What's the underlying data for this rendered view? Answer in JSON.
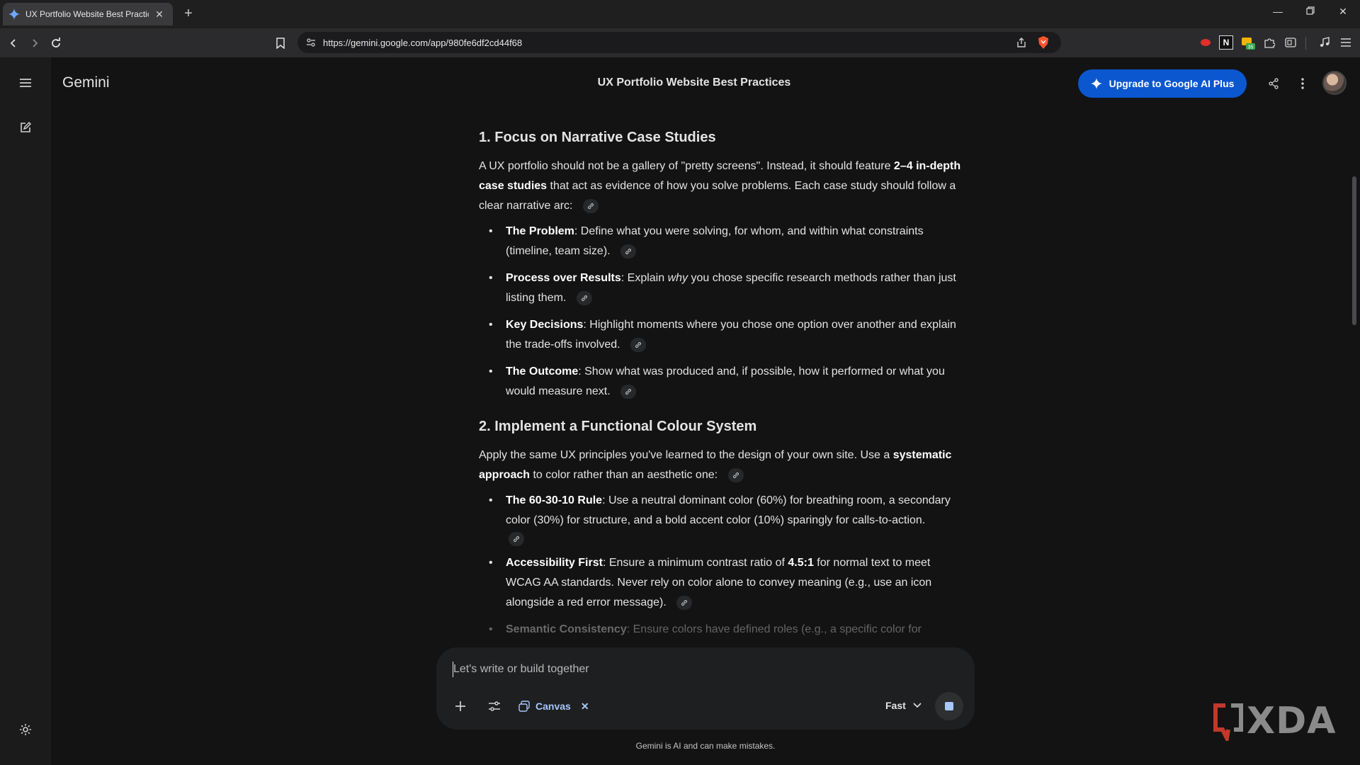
{
  "browser": {
    "tab_title": "UX Portfolio Website Best Practic",
    "url": "https://gemini.google.com/app/980fe6df2cd44f68",
    "extension_badge": "35"
  },
  "app": {
    "brand": "Gemini",
    "conversation_title": "UX Portfolio Website Best Practices",
    "upgrade_label": "Upgrade to Google AI Plus"
  },
  "content": {
    "section1": {
      "heading": "1. Focus on Narrative Case Studies",
      "intro_a": "A UX portfolio should not be a gallery of \"pretty screens\". Instead, it should feature ",
      "intro_bold": "2–4 in-depth case studies",
      "intro_b": " that act as evidence of how you solve problems. Each case study should follow a clear narrative arc:",
      "items": [
        {
          "term": "The Problem",
          "text": ": Define what you were solving, for whom, and within what constraints (timeline, team size)."
        },
        {
          "term": "Process over Results",
          "text_a": ": Explain ",
          "em": "why",
          "text_b": " you chose specific research methods rather than just listing them."
        },
        {
          "term": "Key Decisions",
          "text": ": Highlight moments where you chose one option over another and explain the trade-offs involved."
        },
        {
          "term": "The Outcome",
          "text": ": Show what was produced and, if possible, how it performed or what you would measure next."
        }
      ]
    },
    "section2": {
      "heading": "2. Implement a Functional Colour System",
      "intro_a": "Apply the same UX principles you've learned to the design of your own site. Use a ",
      "intro_bold": "systematic approach",
      "intro_b": " to color rather than an aesthetic one:",
      "items": [
        {
          "term": "The 60-30-10 Rule",
          "text": ": Use a neutral dominant color (60%) for breathing room, a secondary color (30%) for structure, and a bold accent color (10%) sparingly for calls-to-action."
        },
        {
          "term": "Accessibility First",
          "text_a": ": Ensure a minimum contrast ratio of ",
          "bold": "4.5:1",
          "text_b": " for normal text to meet WCAG AA standards. Never rely on color alone to convey meaning (e.g., use an icon alongside a red error message)."
        },
        {
          "term": "Semantic Consistency",
          "text": ": Ensure colors have defined roles (e.g., a specific color for"
        }
      ]
    }
  },
  "composer": {
    "placeholder": "Let's write or build together",
    "tool_chip": "Canvas",
    "model": "Fast"
  },
  "footer": {
    "disclaimer": "Gemini is AI and can make mistakes."
  },
  "watermark": "XDA",
  "colors": {
    "accent": "#0b57d0",
    "link_blue": "#a8c7fa",
    "background": "#131314"
  }
}
